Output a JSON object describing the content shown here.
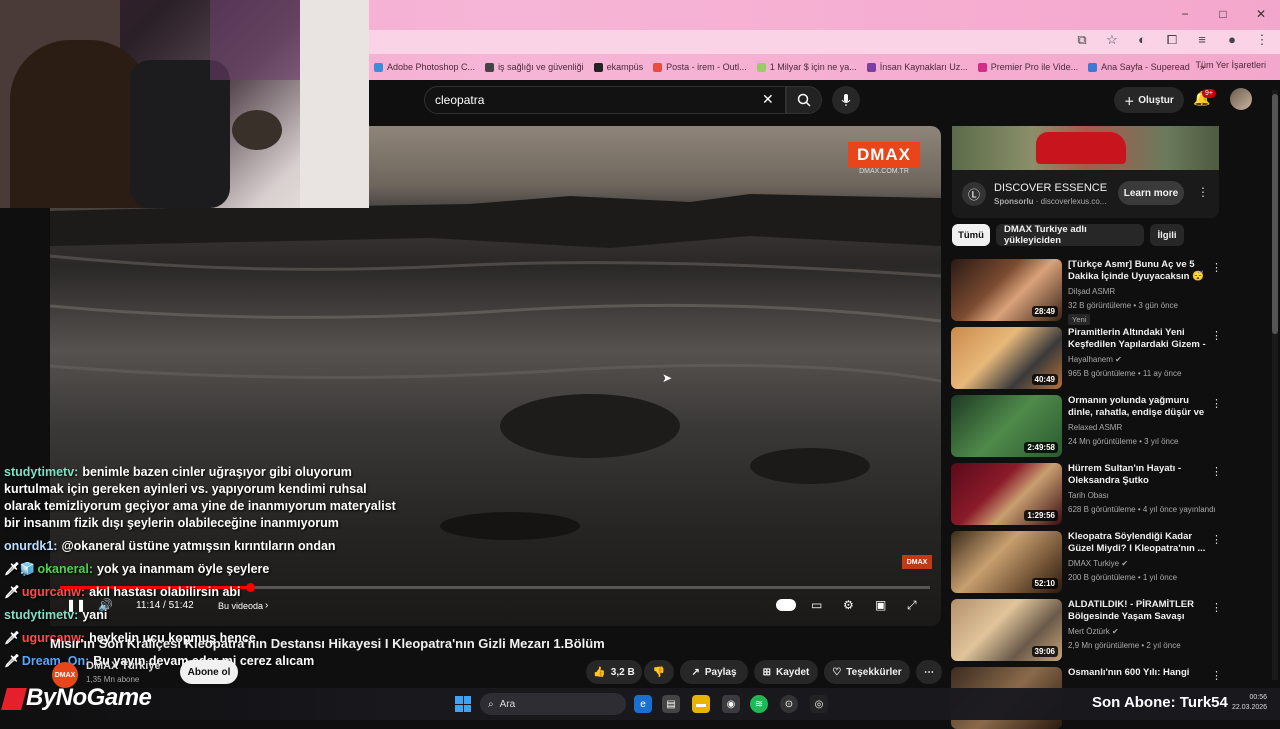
{
  "browser": {
    "window_controls": [
      "−",
      "□",
      "✕"
    ],
    "bookmarks": [
      {
        "label": "Adobe Photoshop C...",
        "color": "#3b8ed6"
      },
      {
        "label": "iş sağlığı ve güvenliği",
        "color": "#444"
      },
      {
        "label": "ekampüs",
        "color": "#222"
      },
      {
        "label": "Posta - irem - Outl...",
        "color": "#e94d3f"
      },
      {
        "label": "1 Milyar $ için ne ya...",
        "color": "#9c6"
      },
      {
        "label": "İnsan Kaynakları Uz...",
        "color": "#7b3fa0"
      },
      {
        "label": "Premier Pro ile Vide...",
        "color": "#d42c8a"
      },
      {
        "label": "Ana Sayfa - Superead",
        "color": "#3b7bd6"
      }
    ],
    "bookmarks_overflow": "»",
    "all_bookmarks": "Tüm Yer İşaretleri"
  },
  "youtube": {
    "search_query": "cleopatra",
    "create_label": "Oluştur",
    "notification_count": "9+"
  },
  "video": {
    "watermark": "DMAX",
    "watermark_url": "DMAX.COM.TR",
    "corner_bug": "DMAX",
    "current_time": "11:14 / 51:42",
    "chapter": "Bu videoda",
    "progress_fraction": 0.218,
    "title": "Mısır'ın Son Kraliçesi Kleopatra'nın Destansı Hikayesi I Kleopatra'nın Gizli Mezarı 1.Bölüm",
    "channel": "DMAX Türkiye",
    "subscribers": "1,35 Mn abone",
    "subscribe_label": "Abone ol",
    "likes": "3,2 B",
    "share_label": "Paylaş",
    "save_label": "Kaydet",
    "thanks_label": "Teşekkürler"
  },
  "chat": [
    {
      "user": "studytimetv:",
      "text": "benimle bazen cinler uğraşıyor gibi oluyorum kurtulmak için gereken ayinleri vs. yapıyorum kendimi ruhsal olarak temizliyorum geçiyor ama yine de inanmıyorum materyalist bir insanım fizik dışı şeylerin olabileceğine inanmıyorum",
      "color": "#7fe0c4",
      "badge": ""
    },
    {
      "user": "onurdk1:",
      "text": "@okaneral üstüne yatmışsın kırıntıların ondan",
      "color": "#b9e0ff",
      "badge": ""
    },
    {
      "user": "okaneral:",
      "text": "yok ya inanmam öyle şeylere",
      "color": "#4ad34a",
      "badge": "🗡🧊"
    },
    {
      "user": "ugurcanw:",
      "text": "akıl hastası olabilirsin abi",
      "color": "#ff4b4b",
      "badge": "🗡"
    },
    {
      "user": "studytimetv:",
      "text": "yani",
      "color": "#7fe0c4",
      "badge": ""
    },
    {
      "user": "ugurcanw:",
      "text": "heykelin ucu kopmuş hence",
      "color": "#ff4b4b",
      "badge": "🗡"
    },
    {
      "user": "Dream_On:",
      "text": "Bu yayın devam eder mi cerez alıcam",
      "color": "#5aa7ff",
      "badge": "🗡"
    }
  ],
  "ad": {
    "title": "DISCOVER ESSENCE",
    "sponsored": "Sponsorlu",
    "domain": "discoverlexus.co...",
    "cta": "Learn more"
  },
  "chips": [
    "Tümü",
    "DMAX Turkiye adlı yükleyiciden",
    "İlgili"
  ],
  "recommendations": [
    {
      "title": "[Türkçe Asmr] Bunu Aç ve 5 Dakika İçinde Uyuyacaksın 😴",
      "channel": "Dilşad ASMR",
      "meta": "32 B görüntüleme • 3 gün önce",
      "duration": "28:49",
      "badge": "Yeni",
      "verified": false,
      "bg": "linear-gradient(135deg,#2a1a14,#7a4a30 40%,#d9a27a 60%,#3a2418)"
    },
    {
      "title": "Piramitlerin Altındaki Yeni Keşfedilen Yapılardaki Gizem - ...",
      "channel": "Hayalhanem",
      "meta": "965 B görüntüleme • 11 ay önce",
      "duration": "40:49",
      "badge": "",
      "verified": true,
      "bg": "linear-gradient(135deg,#c98a4a,#e8b87a 40%,#3a3a3a 70%,#b4713b)"
    },
    {
      "title": "Ormanın yolunda yağmuru dinle, rahatla, endişe düşür ve derin ...",
      "channel": "Relaxed ASMR",
      "meta": "24 Mn görüntüleme • 3 yıl önce",
      "duration": "2:49:58",
      "badge": "",
      "verified": false,
      "bg": "linear-gradient(135deg,#1f3a24,#4f8a4a 50%,#2a5a30)"
    },
    {
      "title": "Hürrem Sultan'ın Hayatı - Oleksandra Şutko",
      "channel": "Tarih Obası",
      "meta": "628 B görüntüleme • 4 yıl önce yayınlandı",
      "duration": "1:29:56",
      "badge": "",
      "verified": false,
      "bg": "linear-gradient(135deg,#5a0a1a,#8a1a2a 40%,#c8a070 60%,#3a0a14)"
    },
    {
      "title": "Kleopatra Söylendiği Kadar Güzel Miydi? I Kleopatra'nın ...",
      "channel": "DMAX Turkiye",
      "meta": "200 B görüntüleme • 1 yıl önce",
      "duration": "52:10",
      "badge": "",
      "verified": true,
      "bg": "linear-gradient(135deg,#3a2a1a,#c8a070 40%,#7a5a3a 70%,#2a1a10)"
    },
    {
      "title": "ALDATILDIK! - PİRAMİTLER Bölgesinde Yaşam Savaşı (Siz...",
      "channel": "Mert Öztürk",
      "meta": "2,9 Mn görüntüleme • 2 yıl önce",
      "duration": "39:06",
      "badge": "",
      "verified": true,
      "bg": "linear-gradient(135deg,#b4906a,#e0c49a 40%,#6a5a4a 70%,#c8a47a)"
    },
    {
      "title": "Osmanlı'nın 600 Yılı: Hangi",
      "channel": "",
      "meta": "",
      "duration": "",
      "badge": "",
      "verified": false,
      "bg": "linear-gradient(135deg,#3a2a20,#8a6a4a 50%,#2a1a10)"
    }
  ],
  "stream_overlay": {
    "brand": "ByNoGame",
    "last_sub": "Son Abone: Turk54"
  },
  "taskbar": {
    "search_label": "Ara",
    "time": "00:56",
    "date": "22.03.2026"
  }
}
